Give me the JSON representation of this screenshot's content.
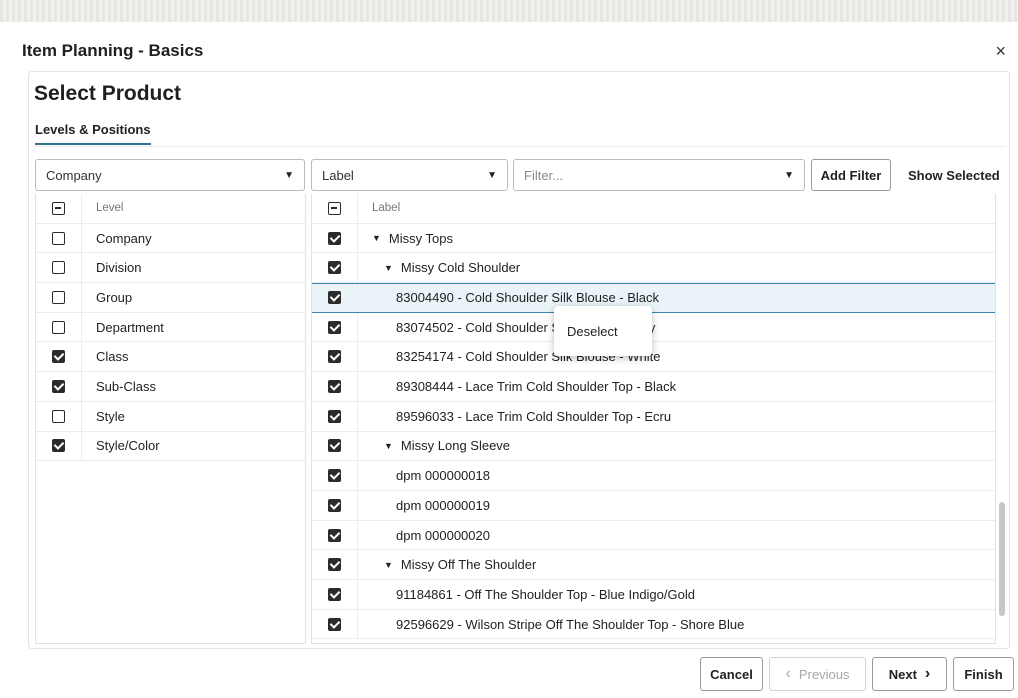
{
  "dialog": {
    "title": "Item Planning - Basics",
    "close_icon": "×"
  },
  "page": {
    "title": "Select Product",
    "tab": "Levels & Positions"
  },
  "toolbar": {
    "level_select": "Company",
    "label_select": "Label",
    "filter_placeholder": "Filter...",
    "add_filter": "Add Filter",
    "show_selected": "Show Selected"
  },
  "levels": {
    "header": "Level",
    "items": [
      {
        "label": "Company",
        "checked": false
      },
      {
        "label": "Division",
        "checked": false
      },
      {
        "label": "Group",
        "checked": false
      },
      {
        "label": "Department",
        "checked": false
      },
      {
        "label": "Class",
        "checked": true
      },
      {
        "label": "Sub-Class",
        "checked": true
      },
      {
        "label": "Style",
        "checked": false
      },
      {
        "label": "Style/Color",
        "checked": true
      }
    ]
  },
  "positions": {
    "header": "Label",
    "items": [
      {
        "label": "Missy Tops",
        "indent": 0,
        "expander": true
      },
      {
        "label": "Missy Cold Shoulder",
        "indent": 1,
        "expander": true
      },
      {
        "label": "83004490 - Cold Shoulder Silk Blouse - Black",
        "indent": 2,
        "expander": false,
        "selected": true
      },
      {
        "label": "83074502 - Cold Shoulder Silk Blouse - Ivory",
        "indent": 2,
        "expander": false
      },
      {
        "label": "83254174 - Cold Shoulder Silk Blouse - White",
        "indent": 2,
        "expander": false
      },
      {
        "label": "89308444 - Lace Trim Cold Shoulder Top - Black",
        "indent": 2,
        "expander": false
      },
      {
        "label": "89596033 - Lace Trim Cold Shoulder Top - Ecru",
        "indent": 2,
        "expander": false
      },
      {
        "label": "Missy Long Sleeve",
        "indent": 1,
        "expander": true
      },
      {
        "label": "dpm 000000018",
        "indent": 2,
        "expander": false
      },
      {
        "label": "dpm 000000019",
        "indent": 2,
        "expander": false
      },
      {
        "label": "dpm 000000020",
        "indent": 2,
        "expander": false
      },
      {
        "label": "Missy Off The Shoulder",
        "indent": 1,
        "expander": true
      },
      {
        "label": "91184861 - Off The Shoulder Top - Blue Indigo/Gold",
        "indent": 2,
        "expander": false
      },
      {
        "label": "92596629 - Wilson Stripe Off The Shoulder Top - Shore Blue",
        "indent": 2,
        "expander": false
      }
    ]
  },
  "context_menu": {
    "item": "Deselect"
  },
  "footer": {
    "cancel": "Cancel",
    "previous": "Previous",
    "next": "Next",
    "finish": "Finish",
    "prev_icon": "‹",
    "next_icon": "›"
  },
  "colors": {
    "accent": "#2f6f8f",
    "selected_row": "#e9f3f8",
    "selected_border": "#3a86b0"
  }
}
